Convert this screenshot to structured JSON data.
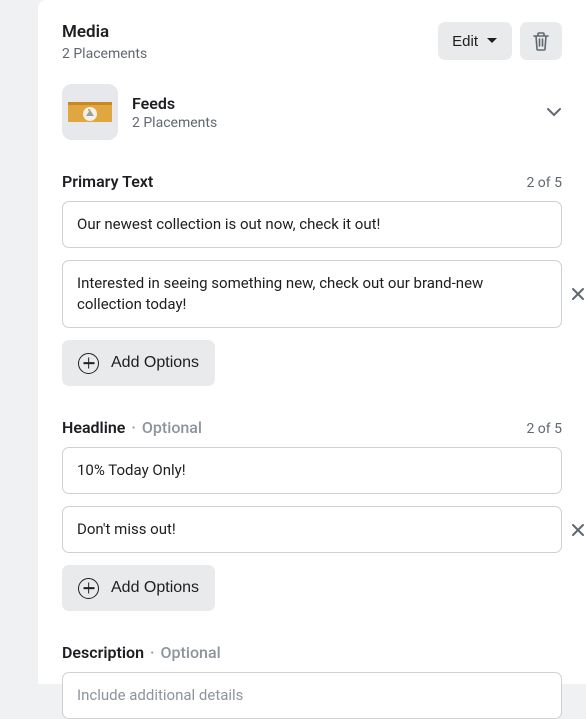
{
  "media": {
    "title": "Media",
    "subtitle": "2 Placements",
    "edit_label": "Edit",
    "feeds": {
      "title": "Feeds",
      "subtitle": "2 Placements"
    }
  },
  "primary_text": {
    "label": "Primary Text",
    "counter": "2 of 5",
    "items": [
      "Our newest collection is out now, check it out!",
      "Interested in seeing something new, check out our brand-new collection today!"
    ],
    "add_label": "Add Options"
  },
  "headline": {
    "label": "Headline",
    "optional": "Optional",
    "counter": "2 of 5",
    "items": [
      "10% Today Only!",
      "Don't miss out!"
    ],
    "add_label": "Add Options"
  },
  "description": {
    "label": "Description",
    "optional": "Optional",
    "placeholder": "Include additional details"
  }
}
